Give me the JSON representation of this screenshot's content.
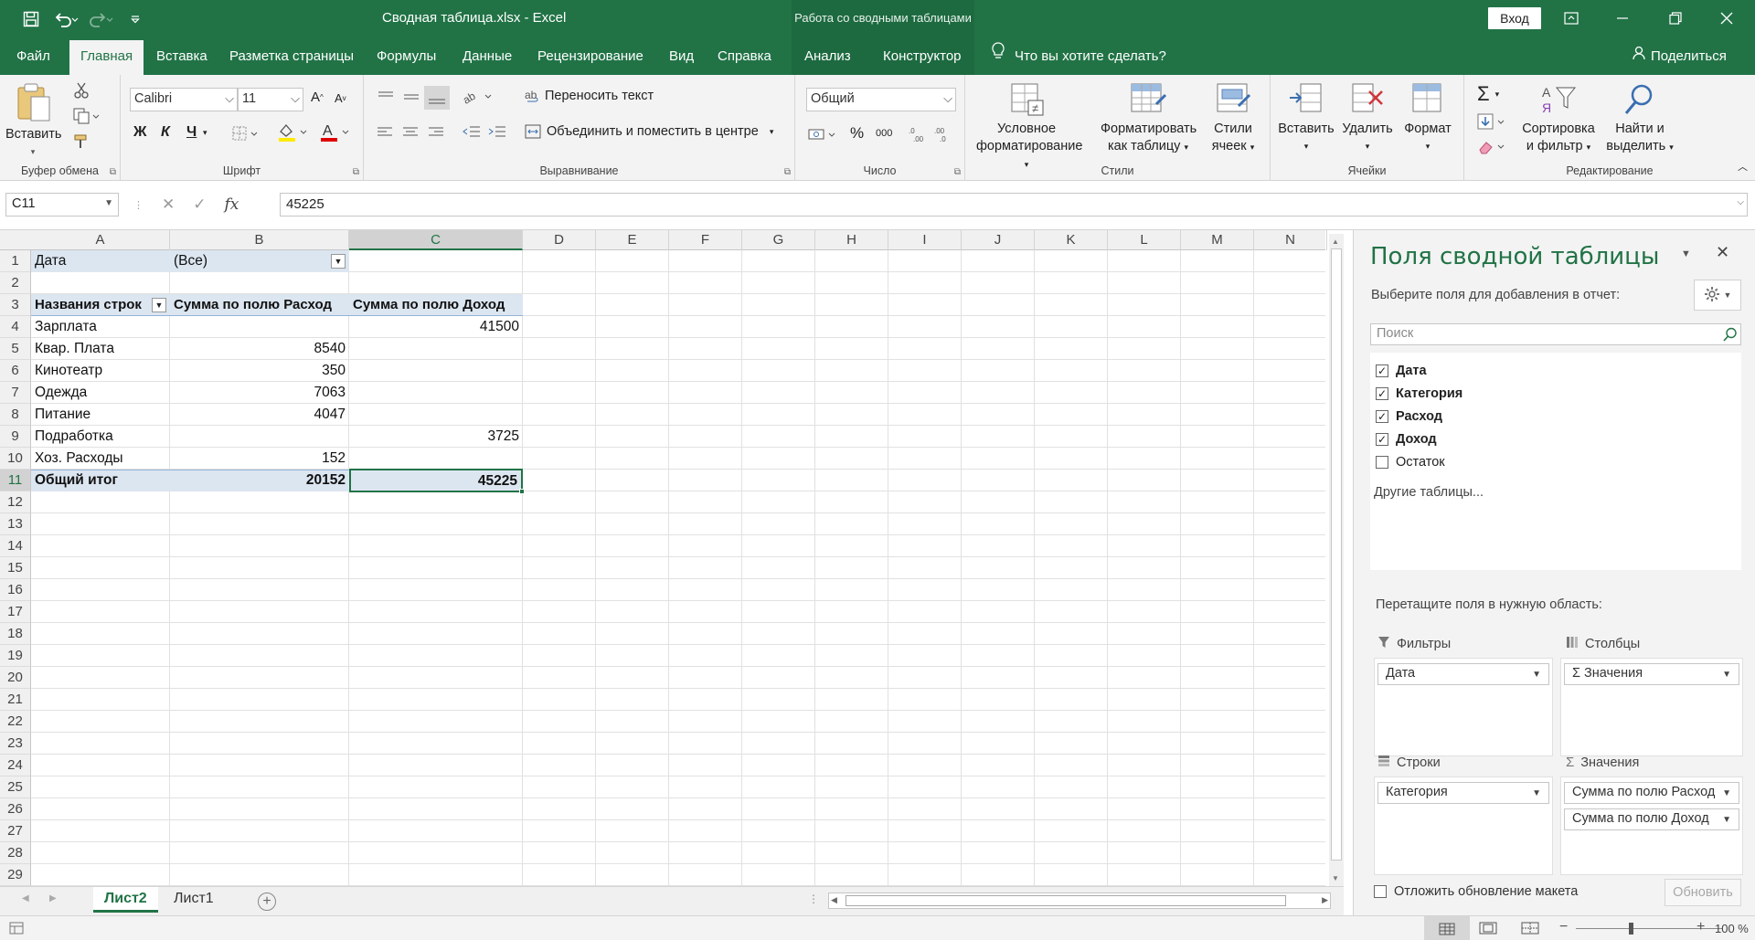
{
  "window": {
    "title": "Сводная таблица.xlsx  -  Excel",
    "context_title": "Работа со сводными таблицами",
    "signin_label": "Вход"
  },
  "tabs": [
    "Файл",
    "Главная",
    "Вставка",
    "Разметка страницы",
    "Формулы",
    "Данные",
    "Рецензирование",
    "Вид",
    "Справка",
    "Анализ",
    "Конструктор"
  ],
  "tellme": "Что вы хотите сделать?",
  "share": "Поделиться",
  "ribbon": {
    "clipboard": {
      "label": "Буфер обмена",
      "paste": "Вставить"
    },
    "font": {
      "label": "Шрифт",
      "name": "Calibri",
      "size": "11",
      "bold": "Ж",
      "italic": "К",
      "underline": "Ч"
    },
    "alignment": {
      "label": "Выравнивание",
      "wrap": "Переносить текст",
      "merge": "Объединить и поместить в центре"
    },
    "number": {
      "label": "Число",
      "format": "Общий",
      "percent": "%",
      "thousands": "000"
    },
    "styles": {
      "label": "Стили",
      "conditional": [
        "Условное",
        "форматирование"
      ],
      "format_table": [
        "Форматировать",
        "как таблицу"
      ],
      "cell_styles": [
        "Стили",
        "ячеек"
      ]
    },
    "cells": {
      "label": "Ячейки",
      "insert": "Вставить",
      "delete": "Удалить",
      "format": "Формат"
    },
    "editing": {
      "label": "Редактирование",
      "sort": [
        "Сортировка",
        "и фильтр"
      ],
      "find": [
        "Найти и",
        "выделить"
      ]
    }
  },
  "formula_bar": {
    "name_box": "C11",
    "value": "45225"
  },
  "grid": {
    "columns": [
      "A",
      "B",
      "C",
      "D",
      "E",
      "F",
      "G",
      "H",
      "I",
      "J",
      "K",
      "L",
      "M",
      "N"
    ],
    "rows": [
      "1",
      "2",
      "3",
      "4",
      "5",
      "6",
      "7",
      "8",
      "9",
      "10",
      "11",
      "12",
      "13",
      "14",
      "15",
      "16",
      "17",
      "18",
      "19",
      "20",
      "21",
      "22",
      "23",
      "24",
      "25",
      "26",
      "27",
      "28",
      "29"
    ],
    "selected_column": "C",
    "selected_row": "11",
    "cells": {
      "A1": "Дата",
      "B1": "(Все)",
      "A3": "Названия строк",
      "B3": "Сумма по полю Расход",
      "C3": "Сумма по полю Доход",
      "A4": "Зарплата",
      "C4": "41500",
      "A5": "Квар. Плата",
      "B5": "8540",
      "A6": "Кинотеатр",
      "B6": "350",
      "A7": "Одежда",
      "B7": "7063",
      "A8": "Питание",
      "B8": "4047",
      "A9": "Подработка",
      "C9": "3725",
      "A10": "Хоз. Расходы",
      "B10": "152",
      "A11": "Общий итог",
      "B11": "20152",
      "C11": "45225"
    }
  },
  "sheets": [
    "Лист2",
    "Лист1"
  ],
  "active_sheet": "Лист2",
  "status": {
    "zoom": "100 %"
  },
  "pivot_pane": {
    "title": "Поля сводной таблицы",
    "subtitle": "Выберите поля для добавления в отчет:",
    "search_placeholder": "Поиск",
    "fields": [
      {
        "name": "Дата",
        "checked": true
      },
      {
        "name": "Категория",
        "checked": true
      },
      {
        "name": "Расход",
        "checked": true
      },
      {
        "name": "Доход",
        "checked": true
      },
      {
        "name": "Остаток",
        "checked": false
      }
    ],
    "more_tables": "Другие таблицы...",
    "drag_hint": "Перетащите поля в нужную область:",
    "areas": {
      "filters": {
        "title": "Фильтры",
        "items": [
          "Дата"
        ]
      },
      "columns": {
        "title": "Столбцы",
        "items": [
          "Σ Значения"
        ]
      },
      "rows": {
        "title": "Строки",
        "items": [
          "Категория"
        ]
      },
      "values": {
        "title": "Значения",
        "items": [
          "Сумма по полю Расход",
          "Сумма по полю Доход"
        ]
      }
    },
    "defer_update": "Отложить обновление макета",
    "update_button": "Обновить"
  },
  "colors": {
    "accent": "#217346",
    "pivot_header": "#dce6f1"
  }
}
